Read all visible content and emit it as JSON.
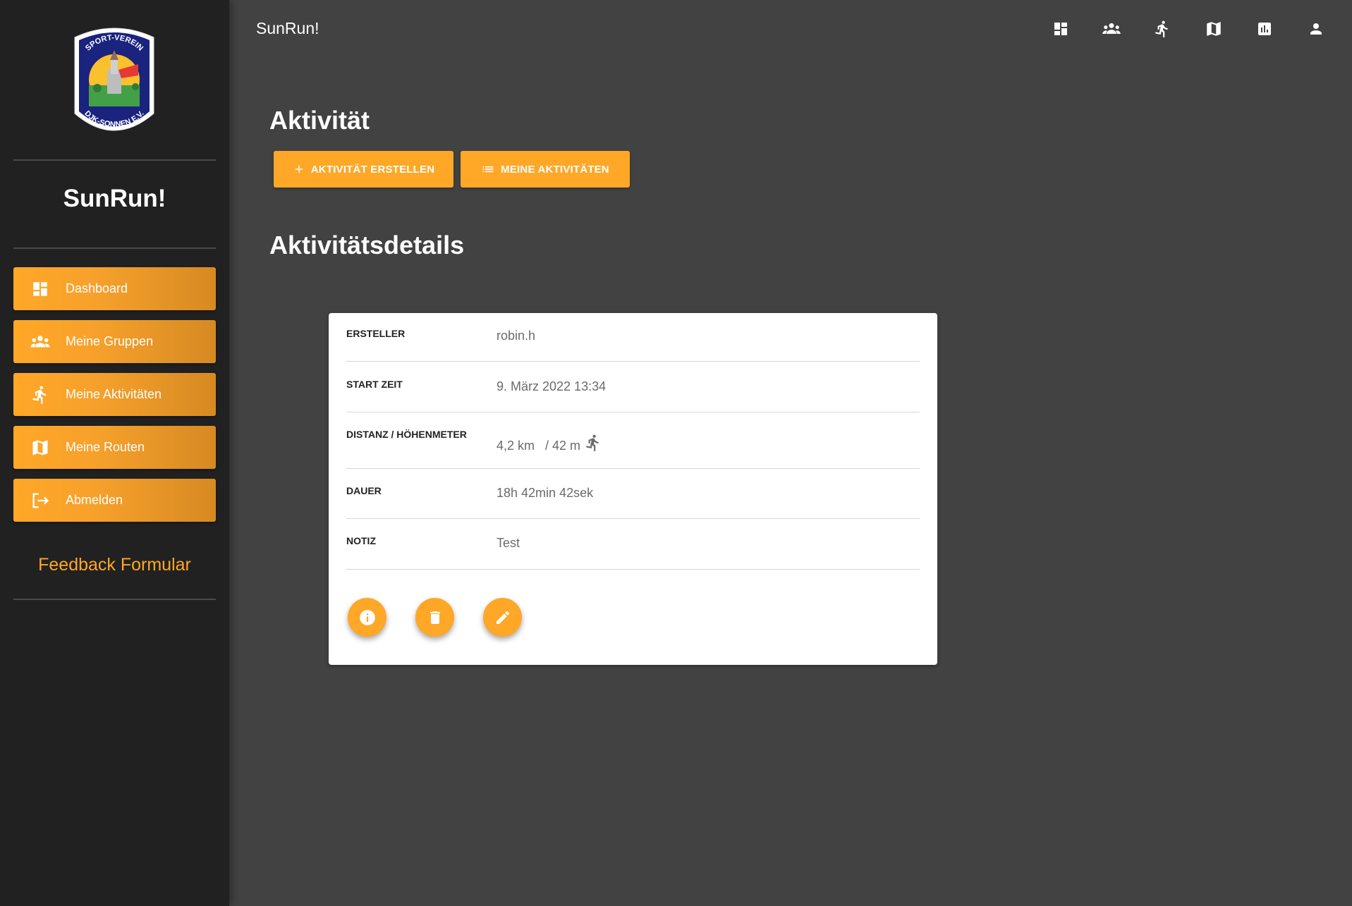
{
  "app": {
    "title": "SunRun!"
  },
  "sidebar": {
    "logo": {
      "top_text": "SPORT-VEREIN",
      "bottom_text": "DJK-SONNEN E.V."
    },
    "brand": "SunRun!",
    "items": [
      {
        "label": "Dashboard",
        "icon": "dashboard-icon"
      },
      {
        "label": "Meine Gruppen",
        "icon": "groups-icon"
      },
      {
        "label": "Meine Aktivitäten",
        "icon": "runner-icon"
      },
      {
        "label": "Meine Routen",
        "icon": "map-icon"
      },
      {
        "label": "Abmelden",
        "icon": "logout-icon"
      }
    ],
    "feedback": "Feedback Formular"
  },
  "topbar": {
    "icons": [
      "dashboard-icon",
      "groups-icon",
      "runner-icon",
      "map-icon",
      "chart-icon",
      "person-icon"
    ]
  },
  "main": {
    "heading": "Aktivität",
    "buttons": {
      "create": "AKTIVITÄT ERSTELLEN",
      "mine": "MEINE AKTIVITÄTEN"
    },
    "details_heading": "Aktivitätsdetails"
  },
  "details": {
    "creator_label": "ERSTELLER",
    "creator_value": "robin.h",
    "start_label": "START ZEIT",
    "start_value": "9. März 2022 13:34",
    "distance_label": "DISTANZ / HÖHENMETER",
    "distance_value": "4,2 km",
    "elevation_value": "/ 42 m",
    "duration_label": "DAUER",
    "duration_value": "18h 42min 42sek",
    "note_label": "NOTIZ",
    "note_value": "Test"
  },
  "colors": {
    "accent": "#ffa726",
    "background": "#424242",
    "sidebar": "#212121"
  }
}
